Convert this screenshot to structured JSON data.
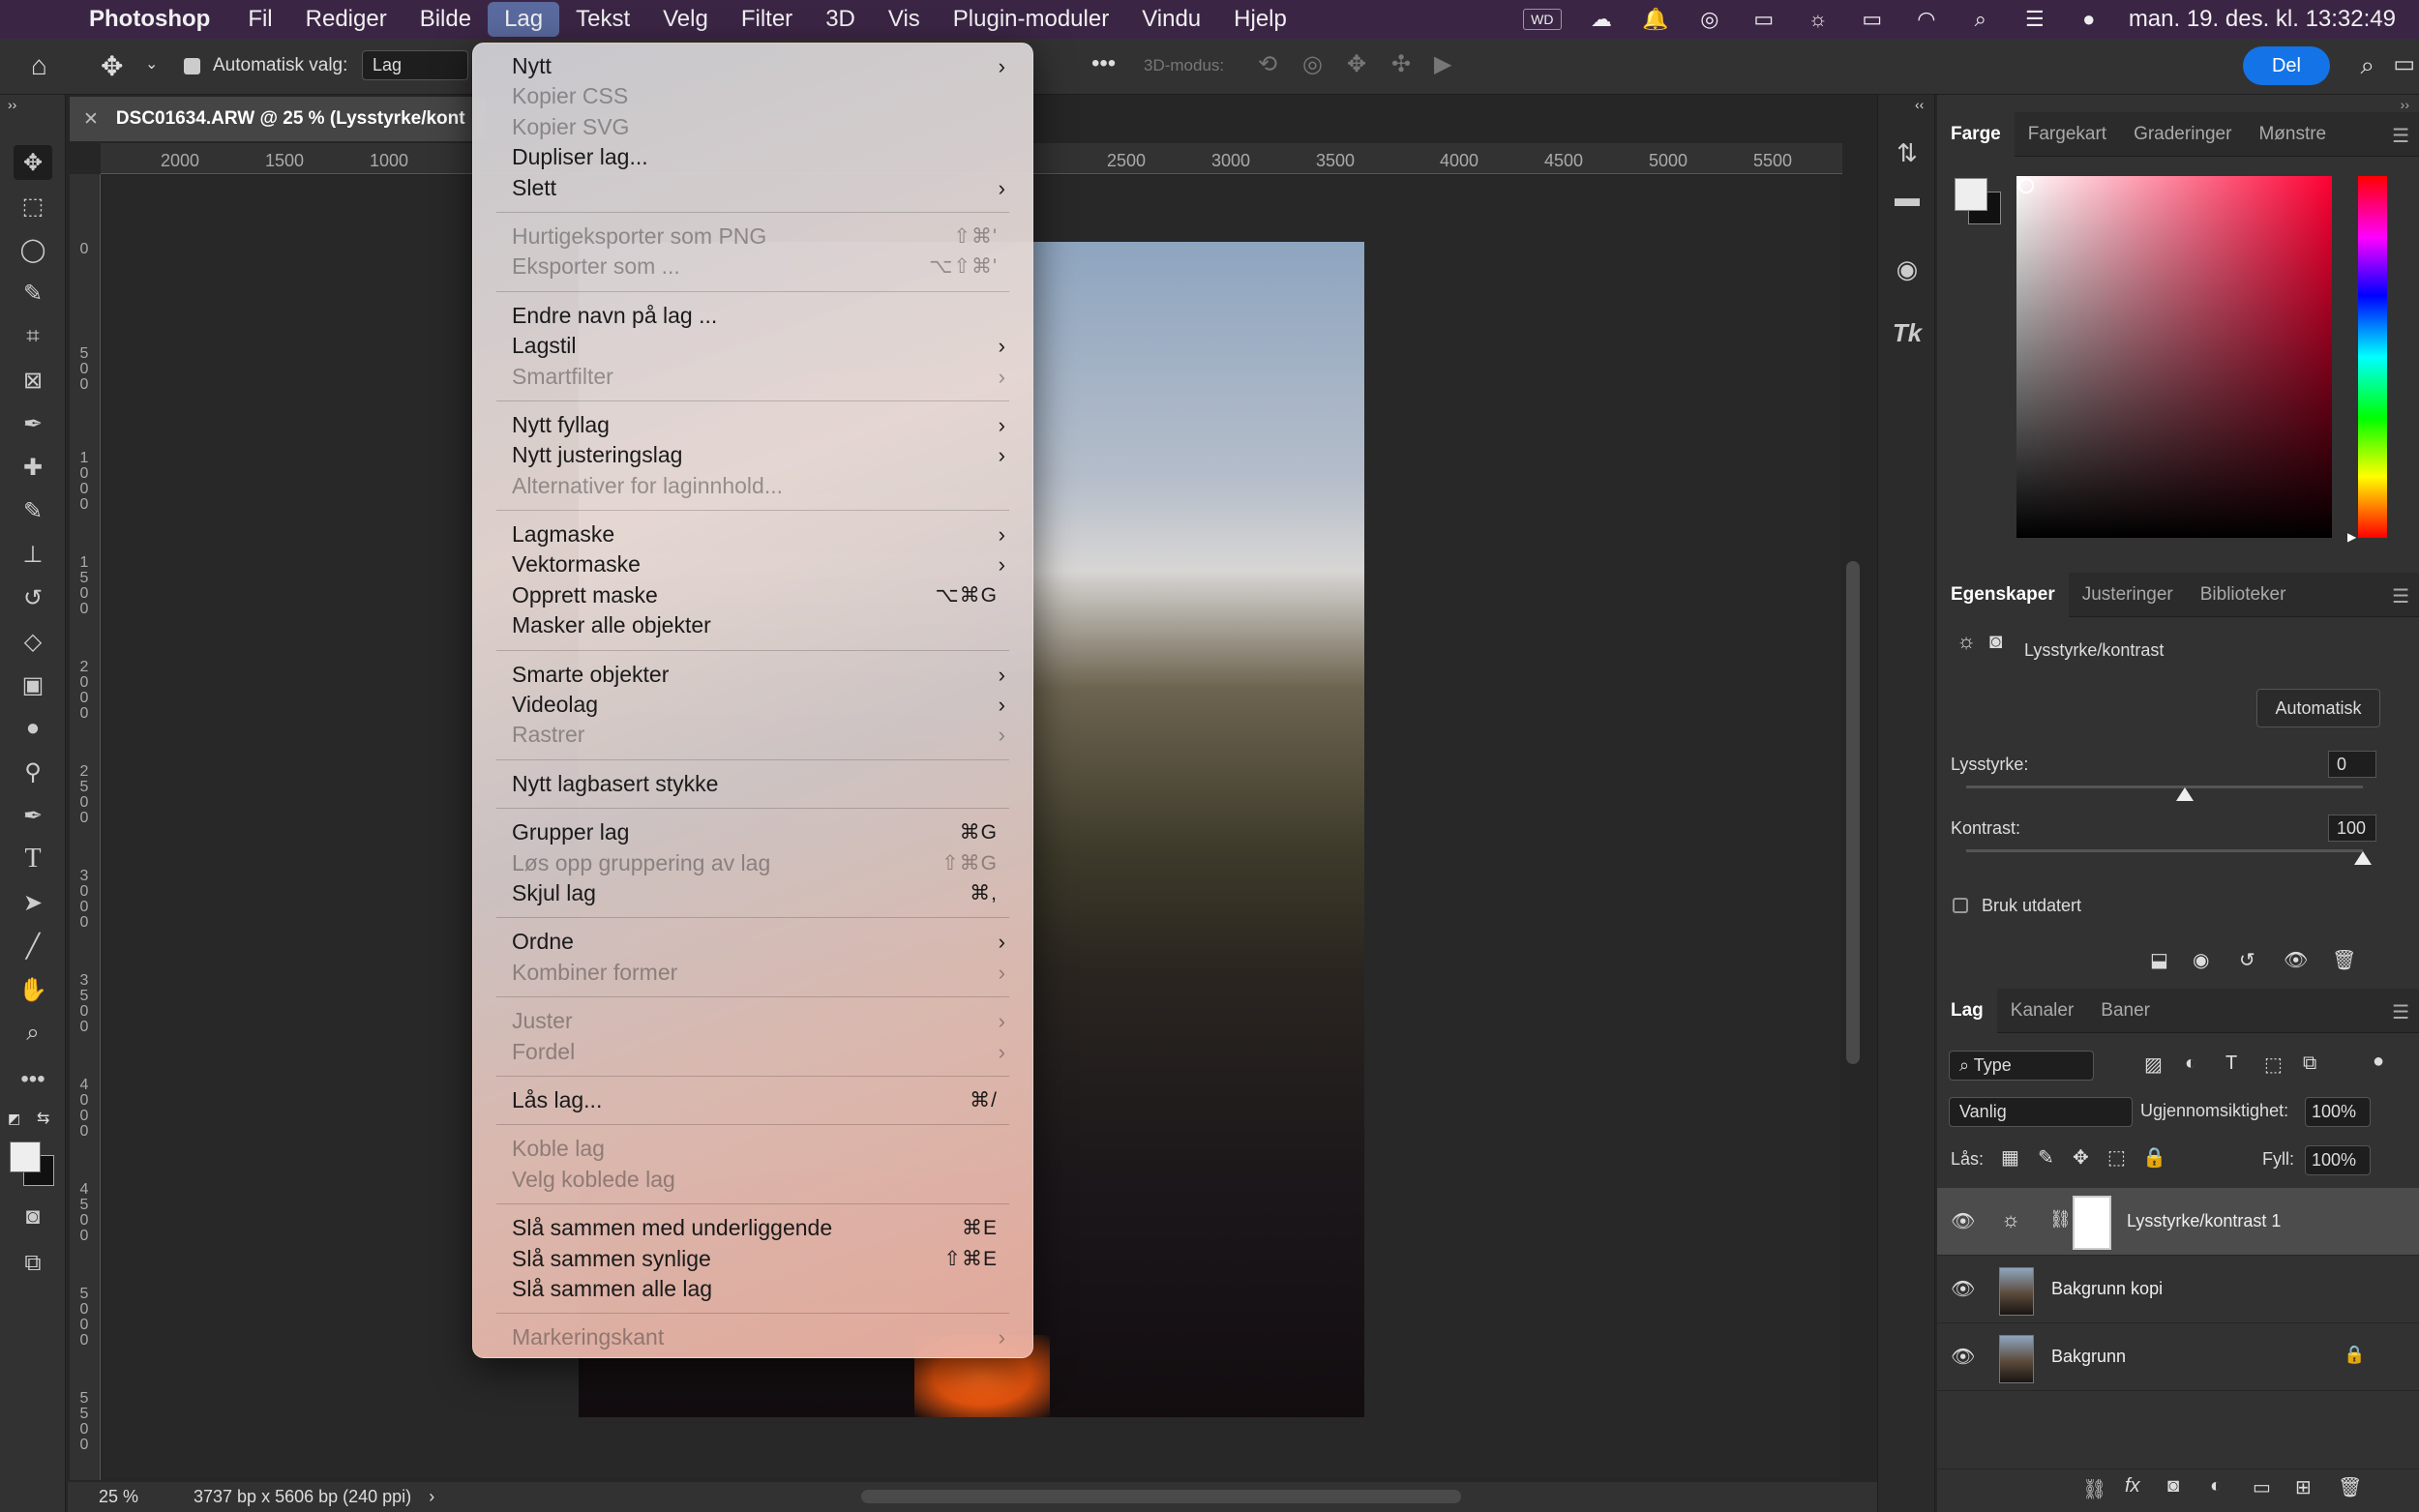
{
  "menubar": {
    "app": "Photoshop",
    "items": [
      "Fil",
      "Rediger",
      "Bilde",
      "Lag",
      "Tekst",
      "Velg",
      "Filter",
      "3D",
      "Vis",
      "Plugin-moduler",
      "Vindu",
      "Hjelp"
    ],
    "active": "Lag",
    "clock": "man. 19. des. kl. 13:32:49",
    "wd_label": "WD"
  },
  "options": {
    "auto_select_label": "Automatisk valg:",
    "auto_select_value": "Lag",
    "mode3d_label": "3D-modus:",
    "share_label": "Del"
  },
  "document": {
    "tab_title": "DSC01634.ARW @ 25 % (Lysstyrke/kont",
    "zoom": "25 %",
    "dimensions": "3737 bp x 5606 bp (240 ppi)",
    "ruler_top": [
      "2000",
      "1500",
      "1000",
      "2500",
      "3000",
      "3500",
      "4000",
      "4500",
      "5000",
      "5500"
    ],
    "ruler_left": [
      "0",
      "500",
      "1000",
      "1500",
      "2000",
      "2500",
      "3000",
      "3500",
      "4000",
      "4500",
      "5000",
      "5500"
    ]
  },
  "lag_menu": [
    {
      "label": "Nytt",
      "submenu": true
    },
    {
      "label": "Kopier CSS",
      "disabled": true
    },
    {
      "label": "Kopier SVG",
      "disabled": true
    },
    {
      "label": "Dupliser lag..."
    },
    {
      "label": "Slett",
      "submenu": true
    },
    {
      "sep": true
    },
    {
      "label": "Hurtigeksporter som PNG",
      "disabled": true,
      "shortcut": "⇧⌘'"
    },
    {
      "label": "Eksporter som ...",
      "disabled": true,
      "shortcut": "⌥⇧⌘'"
    },
    {
      "sep": true
    },
    {
      "label": "Endre navn på lag ..."
    },
    {
      "label": "Lagstil",
      "submenu": true
    },
    {
      "label": "Smartfilter",
      "disabled": true,
      "submenu": true
    },
    {
      "sep": true
    },
    {
      "label": "Nytt fyllag",
      "submenu": true
    },
    {
      "label": "Nytt justeringslag",
      "submenu": true
    },
    {
      "label": "Alternativer for laginnhold...",
      "disabled": true
    },
    {
      "sep": true
    },
    {
      "label": "Lagmaske",
      "submenu": true
    },
    {
      "label": "Vektormaske",
      "submenu": true
    },
    {
      "label": "Opprett maske",
      "shortcut": "⌥⌘G"
    },
    {
      "label": "Masker alle objekter"
    },
    {
      "sep": true
    },
    {
      "label": "Smarte objekter",
      "submenu": true
    },
    {
      "label": "Videolag",
      "submenu": true
    },
    {
      "label": "Rastrer",
      "disabled": true,
      "submenu": true
    },
    {
      "sep": true
    },
    {
      "label": "Nytt lagbasert stykke"
    },
    {
      "sep": true
    },
    {
      "label": "Grupper lag",
      "shortcut": "⌘G"
    },
    {
      "label": "Løs opp gruppering av lag",
      "disabled": true,
      "shortcut": "⇧⌘G"
    },
    {
      "label": "Skjul lag",
      "shortcut": "⌘,"
    },
    {
      "sep": true
    },
    {
      "label": "Ordne",
      "submenu": true
    },
    {
      "label": "Kombiner former",
      "disabled": true,
      "submenu": true
    },
    {
      "sep": true
    },
    {
      "label": "Juster",
      "disabled": true,
      "submenu": true
    },
    {
      "label": "Fordel",
      "disabled": true,
      "submenu": true
    },
    {
      "sep": true
    },
    {
      "label": "Lås lag...",
      "shortcut": "⌘/"
    },
    {
      "sep": true
    },
    {
      "label": "Koble lag",
      "disabled": true
    },
    {
      "label": "Velg koblede lag",
      "disabled": true
    },
    {
      "sep": true
    },
    {
      "label": "Slå sammen med underliggende",
      "shortcut": "⌘E"
    },
    {
      "label": "Slå sammen synlige",
      "shortcut": "⇧⌘E"
    },
    {
      "label": "Slå sammen alle lag"
    },
    {
      "sep": true
    },
    {
      "label": "Markeringskant",
      "disabled": true,
      "submenu": true
    }
  ],
  "color_panel": {
    "tabs": [
      "Farge",
      "Fargekart",
      "Graderinger",
      "Mønstre"
    ]
  },
  "properties_panel": {
    "tabs": [
      "Egenskaper",
      "Justeringer",
      "Biblioteker"
    ],
    "title": "Lysstyrke/kontrast",
    "auto_label": "Automatisk",
    "brightness_label": "Lysstyrke:",
    "brightness_value": "0",
    "brightness_level": 0.55,
    "contrast_label": "Kontrast:",
    "contrast_value": "100",
    "contrast_level": 1.0,
    "legacy_label": "Bruk utdatert"
  },
  "layers_panel": {
    "tabs": [
      "Lag",
      "Kanaler",
      "Baner"
    ],
    "filter_value": "Type",
    "blend_mode": "Vanlig",
    "opacity_label": "Ugjennomsiktighet:",
    "opacity_value": "100%",
    "lock_label": "Lås:",
    "fill_label": "Fyll:",
    "fill_value": "100%",
    "layers": [
      {
        "name": "Lysstyrke/kontrast 1"
      },
      {
        "name": "Bakgrunn kopi"
      },
      {
        "name": "Bakgrunn"
      }
    ]
  }
}
